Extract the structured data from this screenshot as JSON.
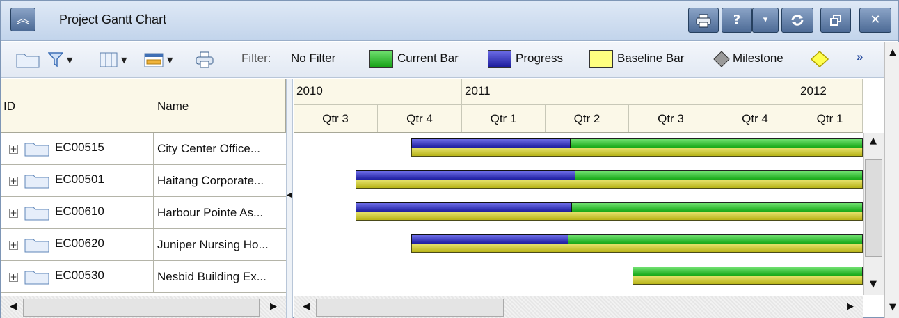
{
  "window": {
    "title": "Project Gantt Chart"
  },
  "titlebar_buttons": {
    "print": "print-icon",
    "help": "?",
    "help_menu": "▾",
    "refresh": "refresh-icon",
    "restore": "restore-icon",
    "close": "✕"
  },
  "toolbar": {
    "filter_label": "Filter:",
    "filter_value": "No Filter",
    "legend": [
      {
        "label": "Current Bar",
        "color": "#22b822"
      },
      {
        "label": "Progress",
        "color": "#2a2aa8"
      },
      {
        "label": "Baseline Bar",
        "color": "#ffff80"
      },
      {
        "label": "Milestone",
        "color": "#8a8a8a"
      }
    ],
    "overflow": "»"
  },
  "grid": {
    "columns": {
      "id": "ID",
      "name": "Name"
    },
    "rows": [
      {
        "id": "EC00515",
        "name": "City Center Office..."
      },
      {
        "id": "EC00501",
        "name": "Haitang Corporate..."
      },
      {
        "id": "EC00610",
        "name": "Harbour Pointe As..."
      },
      {
        "id": "EC00620",
        "name": "Juniper Nursing Ho..."
      },
      {
        "id": "EC00530",
        "name": "Nesbid Building Ex..."
      }
    ]
  },
  "gantt": {
    "years": [
      "2010",
      "2011",
      "2012"
    ],
    "quarters": [
      "Qtr 3",
      "Qtr 4",
      "Qtr 1",
      "Qtr 2",
      "Qtr 3",
      "Qtr 4",
      "Qtr 1"
    ],
    "tasks": [
      {
        "start_q": 1.4,
        "progress_end_q": 3.3
      },
      {
        "start_q": 0.74,
        "progress_end_q": 3.36
      },
      {
        "start_q": 0.74,
        "progress_end_q": 3.32
      },
      {
        "start_q": 1.4,
        "progress_end_q": 3.28
      },
      {
        "start_q": 4.04,
        "progress_end_q": null
      }
    ]
  }
}
